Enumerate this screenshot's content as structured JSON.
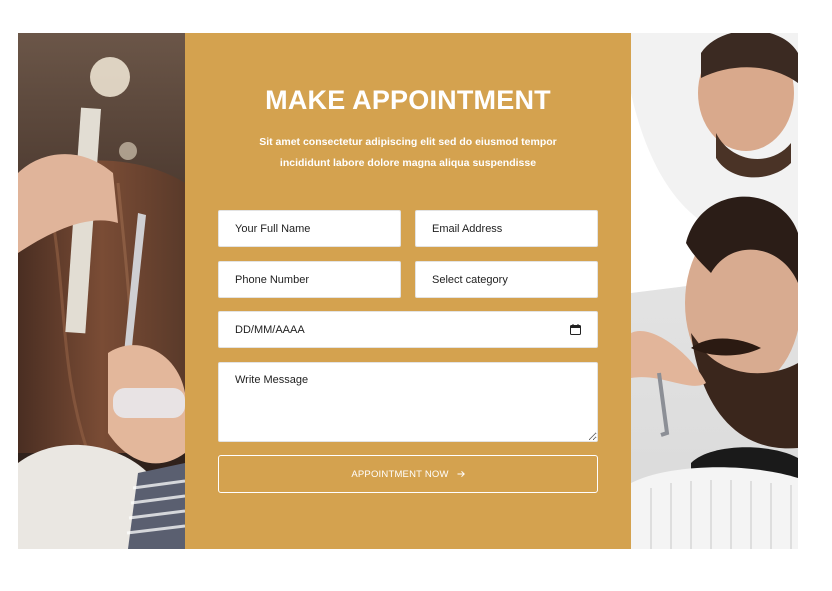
{
  "appointment": {
    "title": "MAKE APPOINTMENT",
    "subtitle": "Sit amet consectetur adipiscing elit sed do eiusmod tempor incididunt labore dolore magna aliqua suspendisse"
  },
  "form": {
    "name_placeholder": "Your Full Name",
    "email_placeholder": "Email Address",
    "phone_placeholder": "Phone Number",
    "category_selected": "Select category",
    "date_placeholder": "DD/MM/AAAA",
    "message_placeholder": "Write Message",
    "submit_label": "APPOINTMENT NOW",
    "icons": {
      "date": "calendar-icon",
      "submit": "arrow-right-icon",
      "message": "resize-handle-icon"
    }
  },
  "colors": {
    "panel_background": "#d4a24f",
    "text_on_panel": "#ffffff",
    "field_background": "#ffffff"
  }
}
